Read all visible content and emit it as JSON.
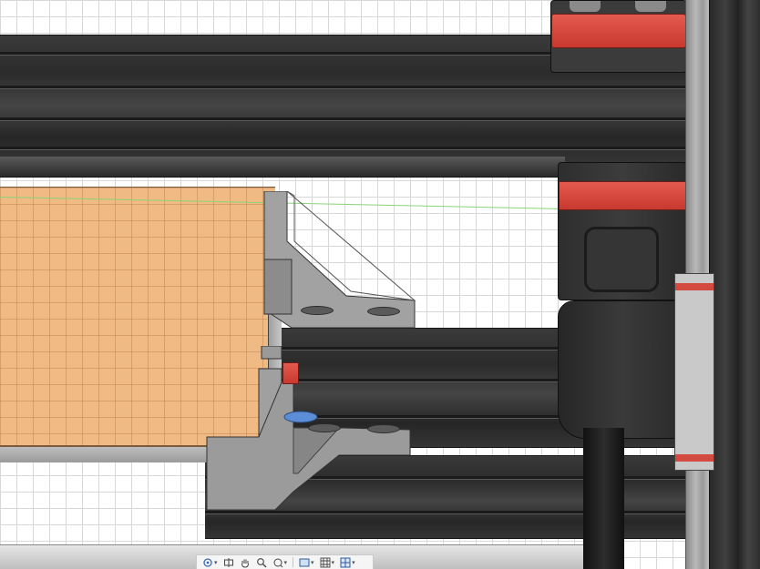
{
  "app": {
    "view": "3d-viewport",
    "background": "#ffffff",
    "grid_color": "#d8d8d8"
  },
  "model": {
    "materials": {
      "extrusion": "#2f2f2f",
      "bracket": "#9a9a9a",
      "bed_plate": "#efba84",
      "accent": "#d9473c",
      "axis_line": "#8ad37a",
      "highlight_face": "#5b8ed6"
    },
    "components": [
      "upper-rail",
      "lower-rail",
      "build-plate",
      "left-bracket-top",
      "left-bracket-bottom",
      "carriage",
      "motor-mount",
      "right-vertical-rail",
      "red-stop-block"
    ]
  },
  "toolbar": {
    "items": [
      {
        "name": "orbit",
        "icon": "orbit-icon",
        "has_menu": true
      },
      {
        "name": "look-at",
        "icon": "look-at-icon",
        "has_menu": false
      },
      {
        "name": "pan",
        "icon": "pan-hand-icon",
        "has_menu": false
      },
      {
        "name": "zoom",
        "icon": "zoom-icon",
        "has_menu": false
      },
      {
        "name": "fit",
        "icon": "fit-icon",
        "has_menu": true
      },
      {
        "name": "display-settings",
        "icon": "display-settings-icon",
        "has_menu": true
      },
      {
        "name": "grid-snaps",
        "icon": "grid-icon",
        "has_menu": true
      },
      {
        "name": "viewports",
        "icon": "viewports-icon",
        "has_menu": true
      }
    ]
  }
}
